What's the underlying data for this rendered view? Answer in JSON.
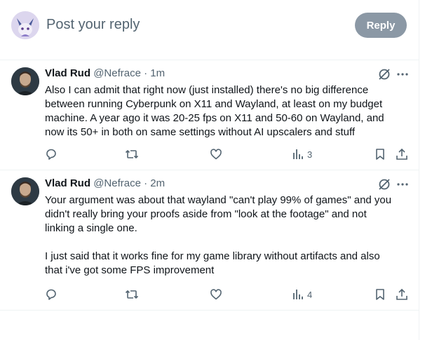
{
  "reply_box": {
    "placeholder": "Post your reply",
    "button_label": "Reply"
  },
  "tweets": [
    {
      "name": "Vlad Rud",
      "handle": "@Nefrace",
      "time": "1m",
      "lines": [
        "Also I can admit that right now (just installed) there's no big difference",
        "between running Cyberpunk on X11 and Wayland, at least on my budget",
        "machine. A year ago it was 20-25 fps on X11 and 50-60 on Wayland, and",
        "now its 50+ in both on same settings without AI upscalers and stuff"
      ],
      "views": "3"
    },
    {
      "name": "Vlad Rud",
      "handle": "@Nefrace",
      "time": "2m",
      "lines": [
        "Your argument was about that wayland \"can't play 99% of games\" and you",
        "didn't really bring your proofs aside from \"look at the footage\" and not",
        "linking a single one.",
        "",
        "I just said that it works fine for my game library without artifacts and also",
        "that i've got some FPS improvement"
      ],
      "views": "4"
    }
  ],
  "icons": [
    "reply-icon",
    "repost-icon",
    "like-icon",
    "views-icon",
    "bookmark-icon",
    "share-icon",
    "grok-icon",
    "more-icon"
  ]
}
